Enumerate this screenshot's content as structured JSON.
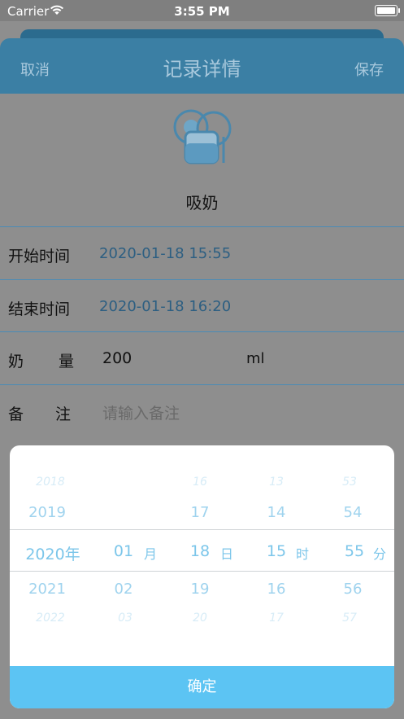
{
  "status_bar": {
    "carrier": "Carrier",
    "time": "3:55 PM"
  },
  "nav": {
    "cancel_label": "取消",
    "title": "记录详情",
    "save_label": "保存"
  },
  "record": {
    "category": "吸奶",
    "start_label": "开始时间",
    "start_value": "2020-01-18 15:55",
    "end_label": "结束时间",
    "end_value": "2020-01-18 16:20",
    "amount_label_a": "奶",
    "amount_label_b": "量",
    "amount_value": "200",
    "amount_unit": "ml",
    "note_label_a": "备",
    "note_label_b": "注",
    "note_placeholder": "请输入备注"
  },
  "picker": {
    "year": {
      "items": [
        "2018",
        "2019",
        "2020年",
        "2021",
        "2022"
      ]
    },
    "month": {
      "items": [
        "",
        "",
        "01",
        "02",
        "03"
      ],
      "unit": "月"
    },
    "day": {
      "items": [
        "16",
        "17",
        "18",
        "19",
        "20"
      ],
      "unit": "日"
    },
    "hour": {
      "items": [
        "13",
        "14",
        "15",
        "16",
        "17"
      ],
      "unit": "时"
    },
    "minute": {
      "items": [
        "53",
        "54",
        "55",
        "56",
        "57"
      ],
      "unit": "分"
    },
    "confirm_label": "确定"
  }
}
